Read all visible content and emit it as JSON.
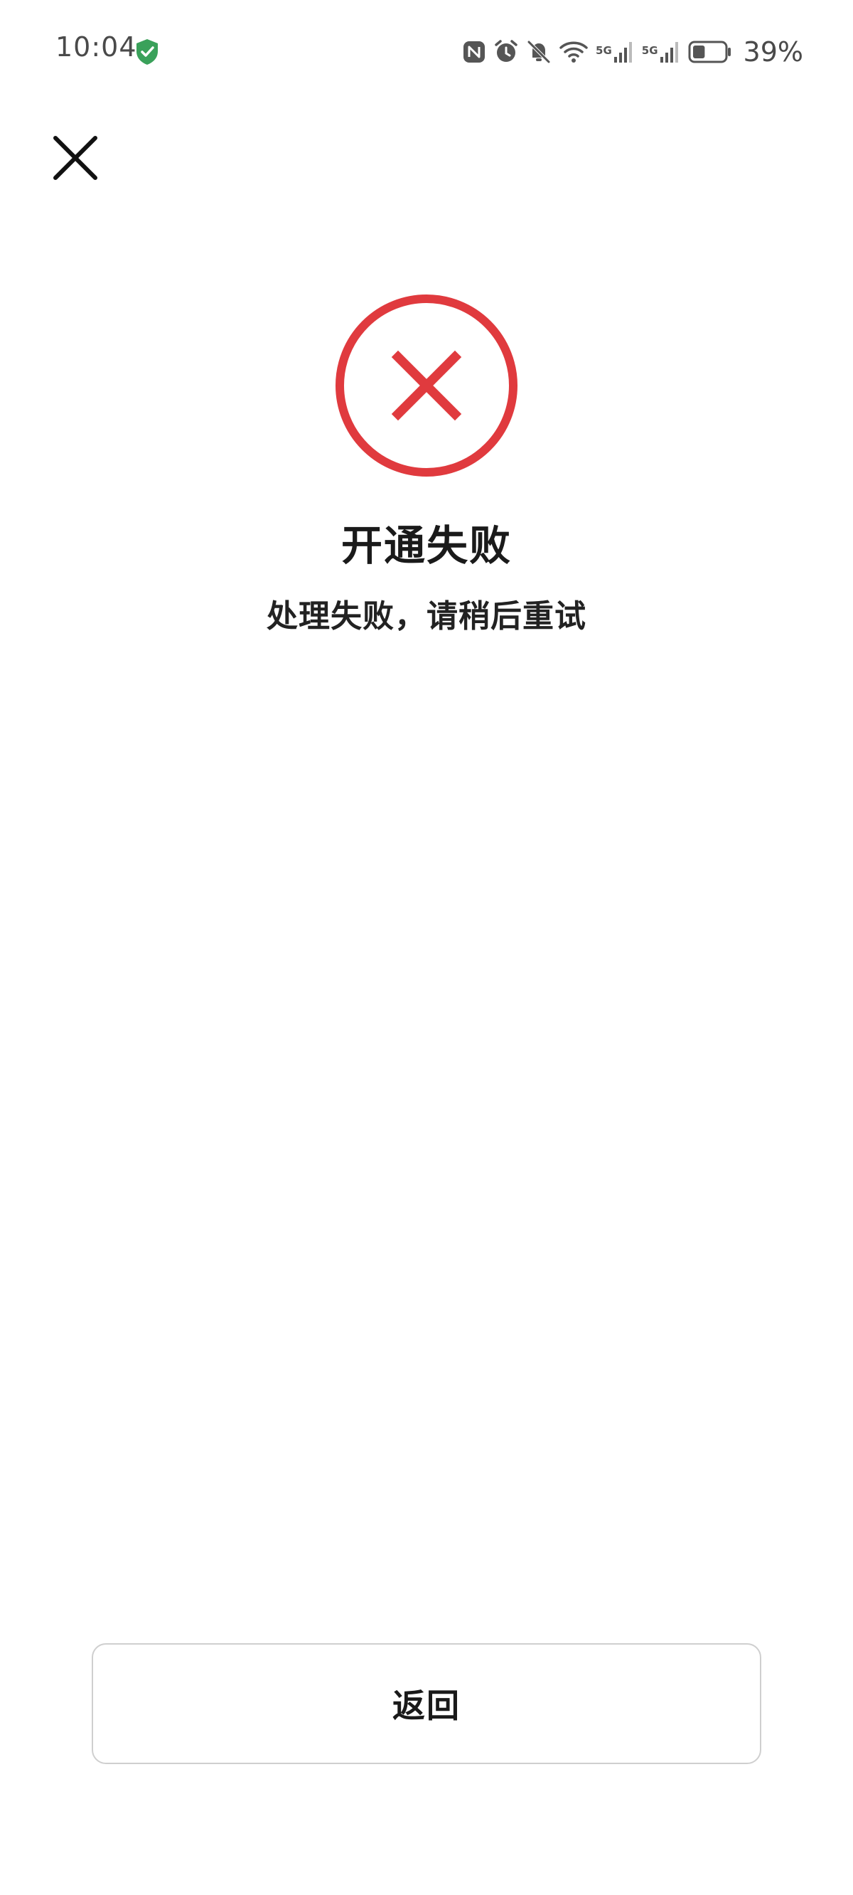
{
  "status_bar": {
    "time": "10:04",
    "network_1": "5G",
    "network_2": "5G",
    "battery_percent": "39%",
    "icons": [
      "security-shield-icon",
      "nfc-icon",
      "alarm-icon",
      "mute-icon",
      "wifi-icon",
      "signal-icon",
      "signal-icon",
      "battery-icon"
    ],
    "battery_level": 0.39,
    "shield_color": "#3aa15a"
  },
  "header": {
    "close_icon": "close-icon"
  },
  "result": {
    "icon": "error-circle-x-icon",
    "icon_color": "#e03a3e",
    "title": "开通失败",
    "message": "处理失败，请稍后重试"
  },
  "footer": {
    "back_label": "返回"
  }
}
